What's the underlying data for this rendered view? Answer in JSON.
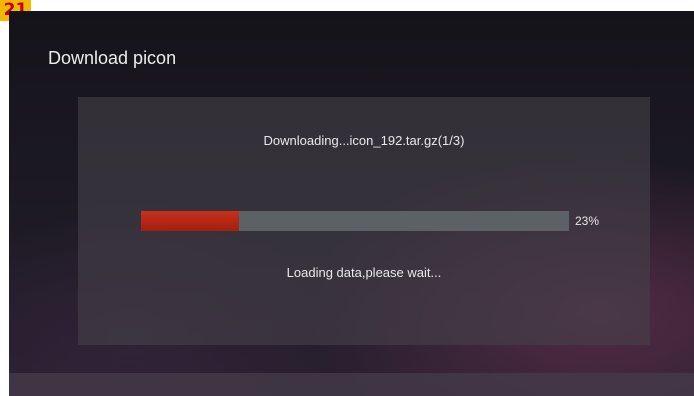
{
  "badge": "21",
  "window": {
    "title": "Download picon"
  },
  "dialog": {
    "message": "Downloading...icon_192.tar.gz(1/3)",
    "progress": {
      "value": 0.23,
      "label": "23%"
    },
    "status": "Loading data,please wait..."
  },
  "colors": {
    "progress_fill": "#b8281a",
    "progress_track": "#5b6164",
    "badge_bg": "#f5b800",
    "badge_text": "#c0001a"
  }
}
